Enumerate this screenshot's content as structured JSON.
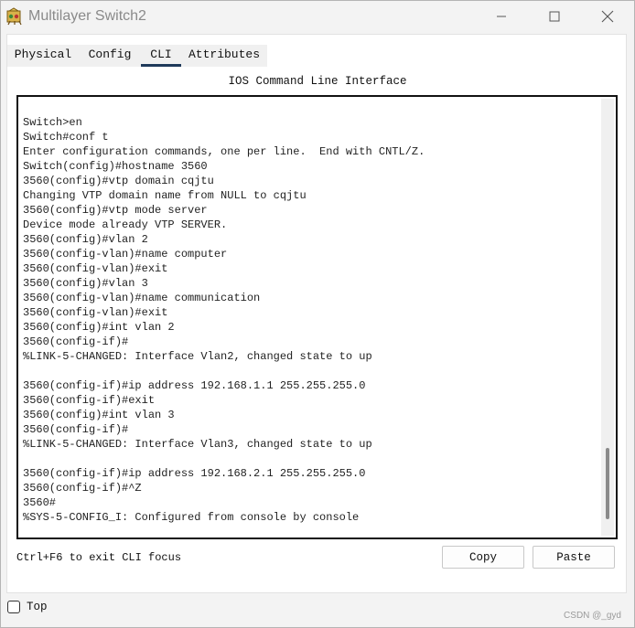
{
  "window": {
    "title": "Multilayer Switch2",
    "app_icon": "packet-tracer-switch-icon"
  },
  "tabs": [
    {
      "label": "Physical",
      "active": false
    },
    {
      "label": "Config",
      "active": false
    },
    {
      "label": "CLI",
      "active": true
    },
    {
      "label": "Attributes",
      "active": false
    }
  ],
  "cli": {
    "header": "IOS Command Line Interface",
    "lines": [
      "Switch>en",
      "Switch#conf t",
      "Enter configuration commands, one per line.  End with CNTL/Z.",
      "Switch(config)#hostname 3560",
      "3560(config)#vtp domain cqjtu",
      "Changing VTP domain name from NULL to cqjtu",
      "3560(config)#vtp mode server",
      "Device mode already VTP SERVER.",
      "3560(config)#vlan 2",
      "3560(config-vlan)#name computer",
      "3560(config-vlan)#exit",
      "3560(config)#vlan 3",
      "3560(config-vlan)#name communication",
      "3560(config-vlan)#exit",
      "3560(config)#int vlan 2",
      "3560(config-if)#",
      "%LINK-5-CHANGED: Interface Vlan2, changed state to up",
      "",
      "3560(config-if)#ip address 192.168.1.1 255.255.255.0",
      "3560(config-if)#exit",
      "3560(config)#int vlan 3",
      "3560(config-if)#",
      "%LINK-5-CHANGED: Interface Vlan3, changed state to up",
      "",
      "3560(config-if)#ip address 192.168.2.1 255.255.255.0",
      "3560(config-if)#^Z",
      "3560#",
      "%SYS-5-CONFIG_I: Configured from console by console"
    ],
    "hint": "Ctrl+F6 to exit CLI focus",
    "copy_label": "Copy",
    "paste_label": "Paste"
  },
  "footer": {
    "top_label": "Top",
    "top_checked": false,
    "watermark": "CSDN @_gyd"
  }
}
